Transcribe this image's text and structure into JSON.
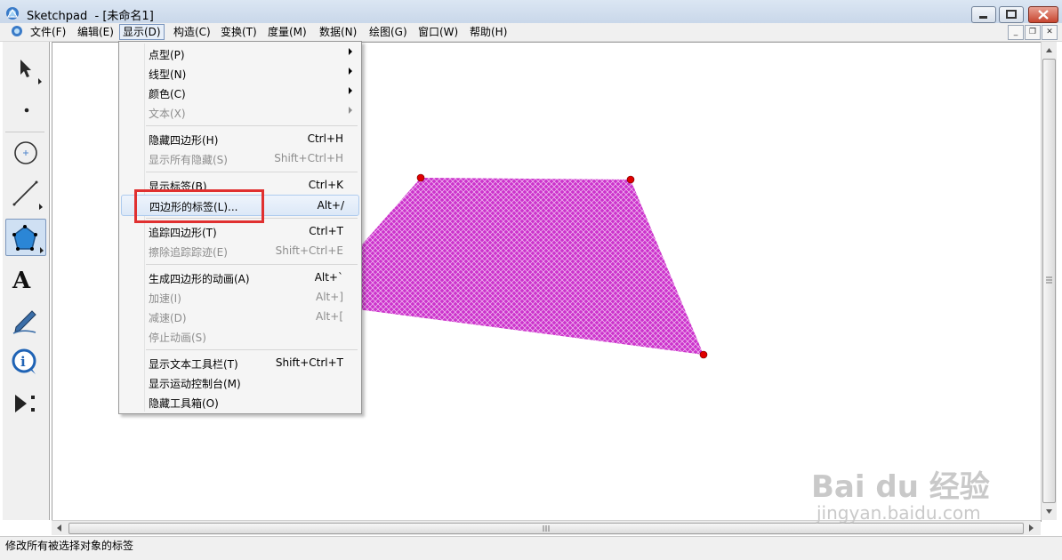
{
  "window": {
    "title": "Sketchpad  - [未命名1]"
  },
  "menubar": {
    "items": [
      {
        "label": "文件(F)"
      },
      {
        "label": "编辑(E)"
      },
      {
        "label": "显示(D)"
      },
      {
        "label": "构造(C)"
      },
      {
        "label": "变换(T)"
      },
      {
        "label": "度量(M)"
      },
      {
        "label": "数据(N)"
      },
      {
        "label": "绘图(G)"
      },
      {
        "label": "窗口(W)"
      },
      {
        "label": "帮助(H)"
      }
    ],
    "active": "显示(D)"
  },
  "toolbox": {
    "tools": [
      "arrow-select-tool",
      "point-tool",
      "compass-tool",
      "straightedge-tool",
      "polygon-tool",
      "text-tool",
      "marker-tool",
      "information-tool",
      "custom-tool"
    ],
    "selected": "polygon-tool"
  },
  "display_menu": {
    "items": [
      {
        "label": "点型(P)",
        "shortcut": "",
        "submenu": true,
        "disabled": false
      },
      {
        "label": "线型(N)",
        "shortcut": "",
        "submenu": true,
        "disabled": false
      },
      {
        "label": "颜色(C)",
        "shortcut": "",
        "submenu": true,
        "disabled": false
      },
      {
        "label": "文本(X)",
        "shortcut": "",
        "submenu": true,
        "disabled": true
      },
      {
        "label": "隐藏四边形(H)",
        "shortcut": "Ctrl+H",
        "submenu": false,
        "disabled": false
      },
      {
        "label": "显示所有隐藏(S)",
        "shortcut": "Shift+Ctrl+H",
        "submenu": false,
        "disabled": true
      },
      {
        "label": "显示标签(B)",
        "shortcut": "Ctrl+K",
        "submenu": false,
        "disabled": false
      },
      {
        "label": "四边形的标签(L)...",
        "shortcut": "Alt+/",
        "submenu": false,
        "disabled": false
      },
      {
        "label": "追踪四边形(T)",
        "shortcut": "Ctrl+T",
        "submenu": false,
        "disabled": false
      },
      {
        "label": "擦除追踪踪迹(E)",
        "shortcut": "Shift+Ctrl+E",
        "submenu": false,
        "disabled": true
      },
      {
        "label": "生成四边形的动画(A)",
        "shortcut": "Alt+`",
        "submenu": false,
        "disabled": false
      },
      {
        "label": "加速(I)",
        "shortcut": "Alt+]",
        "submenu": false,
        "disabled": true
      },
      {
        "label": "减速(D)",
        "shortcut": "Alt+[",
        "submenu": false,
        "disabled": true
      },
      {
        "label": "停止动画(S)",
        "shortcut": "",
        "submenu": false,
        "disabled": true
      },
      {
        "label": "显示文本工具栏(T)",
        "shortcut": "Shift+Ctrl+T",
        "submenu": false,
        "disabled": false
      },
      {
        "label": "显示运动控制台(M)",
        "shortcut": "",
        "submenu": false,
        "disabled": false
      },
      {
        "label": "隐藏工具箱(O)",
        "shortcut": "",
        "submenu": false,
        "disabled": false
      }
    ],
    "highlighted": "四边形的标签(L)..."
  },
  "canvas": {
    "shape": "quadrilateral",
    "fill_color": "#cc33cc",
    "vertex_color": "#e00000"
  },
  "statusbar": {
    "text": "修改所有被选择对象的标签"
  },
  "watermark": {
    "main": "Bai  du 经验",
    "sub": "jingyan.baidu.com"
  },
  "colors": {
    "highlight_box": "#e03030"
  }
}
